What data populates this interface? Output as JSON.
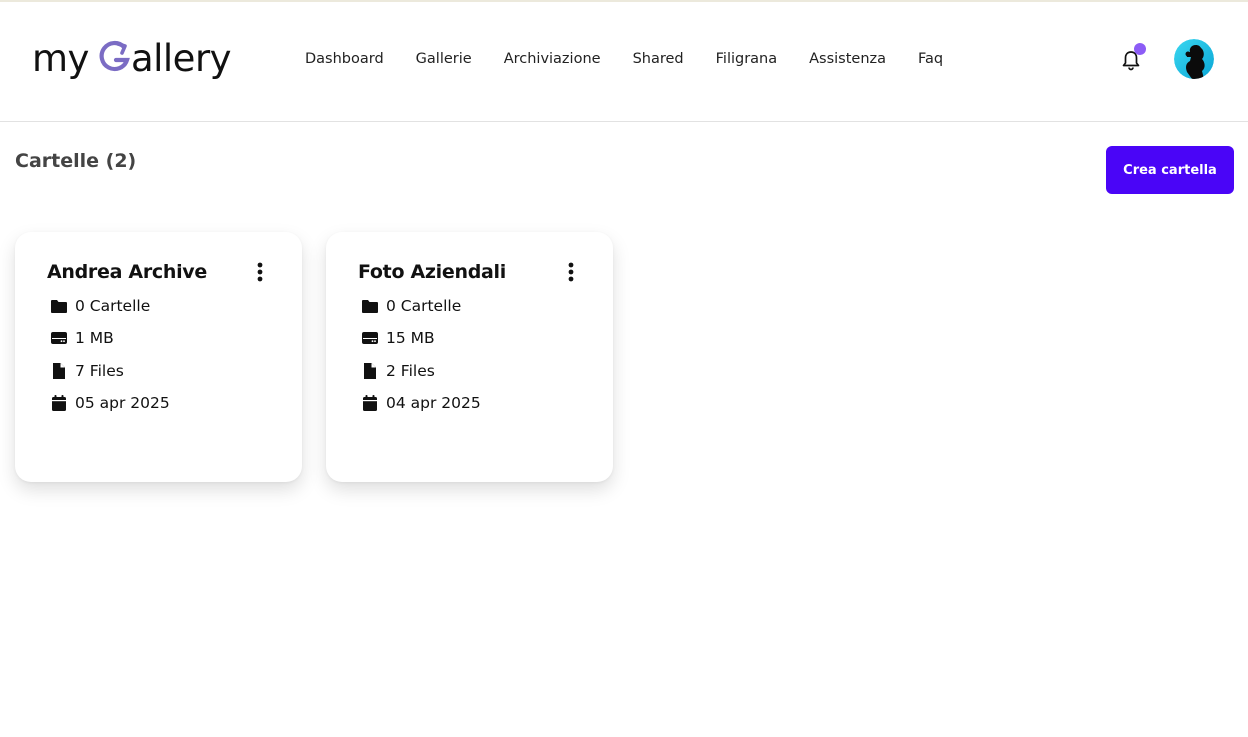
{
  "brand": {
    "prefix": "my",
    "suffix": "allery",
    "accent_color": "#7b6cc4"
  },
  "nav": {
    "items": [
      {
        "label": "Dashboard"
      },
      {
        "label": "Gallerie"
      },
      {
        "label": "Archiviazione"
      },
      {
        "label": "Shared"
      },
      {
        "label": "Filigrana"
      },
      {
        "label": "Assistenza"
      },
      {
        "label": "Faq"
      }
    ]
  },
  "header": {
    "notification_icon": "bell-icon",
    "notification_dot_color": "#8c5cf6",
    "avatar_icon": "user-avatar"
  },
  "main": {
    "title": "Cartelle (2)",
    "create_button_label": "Crea cartella",
    "create_button_color": "#4a05f7"
  },
  "folders": [
    {
      "name": "Andrea Archive",
      "subfolders": "0 Cartelle",
      "size": "1 MB",
      "files": "7 Files",
      "date": "05 apr 2025"
    },
    {
      "name": "Foto Aziendali",
      "subfolders": "0 Cartelle",
      "size": "15 MB",
      "files": "2 Files",
      "date": "04 apr 2025"
    }
  ],
  "icons": {
    "menu": "more-vertical-icon",
    "folder": "folder-icon",
    "storage": "hard-drive-icon",
    "file": "file-icon",
    "date": "calendar-icon"
  }
}
